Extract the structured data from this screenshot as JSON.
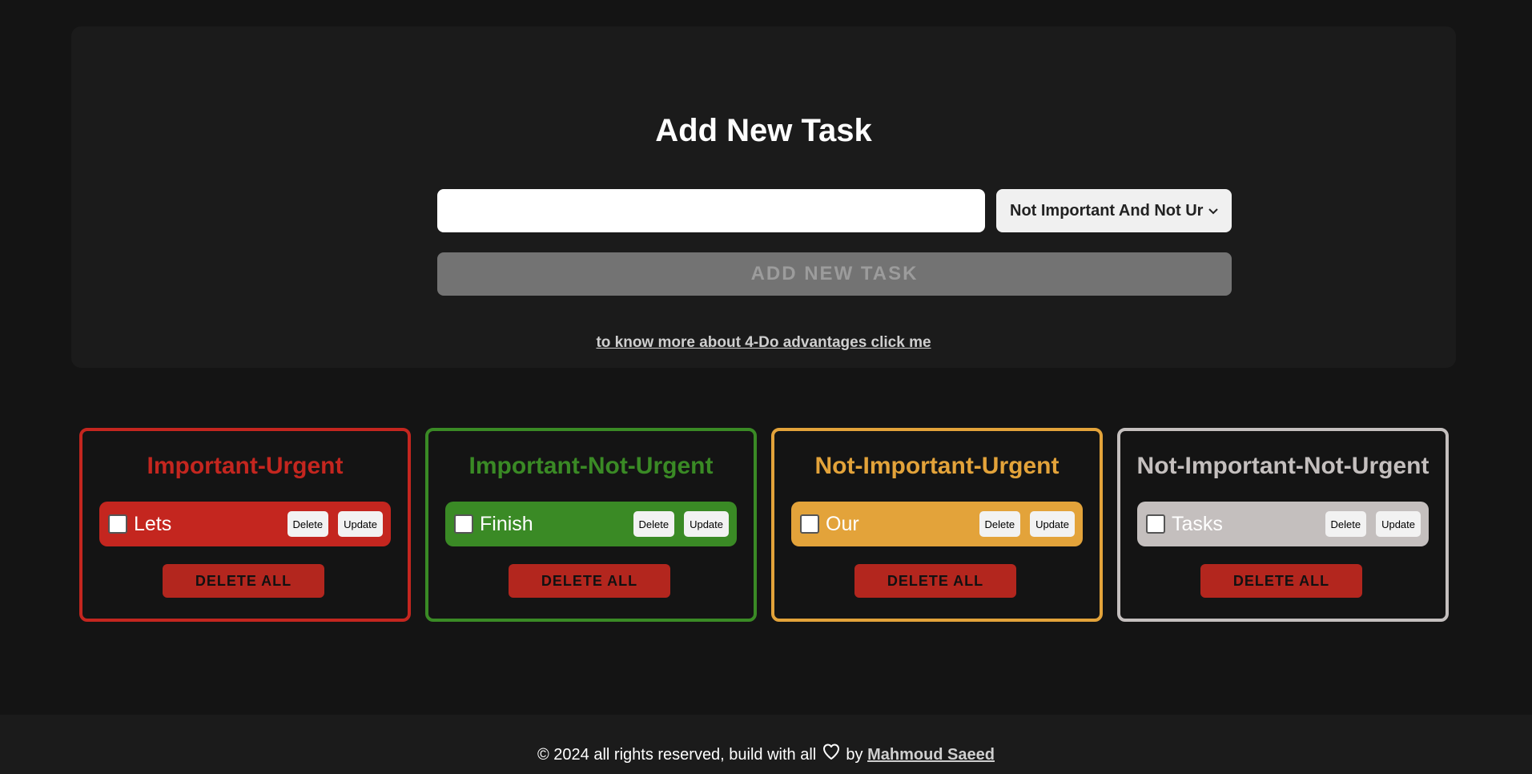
{
  "colors": {
    "page_bg": "#141414",
    "panel_bg": "#1b1b1b",
    "important_urgent": "#c4261f",
    "important_not_urgent": "#3a8a25",
    "not_important_urgent": "#e3a33a",
    "not_important_not_urgent": "#c4bfbe",
    "delete_all_bg": "#b3261e",
    "add_button_bg": "#737373"
  },
  "add_panel": {
    "title": "Add New Task",
    "task_input_value": "",
    "category_selected": "Not Important And Not Urgent",
    "category_visible_text": "Not Important And Not Ur",
    "add_button_label": "ADD NEW TASK",
    "info_link": "to know more about 4-Do advantages click me"
  },
  "boards": [
    {
      "title": "Important-Urgent",
      "tasks": [
        {
          "text": "Lets",
          "delete_label": "Delete",
          "update_label": "Update"
        }
      ],
      "delete_all_label": "DELETE ALL"
    },
    {
      "title": "Important-Not-Urgent",
      "tasks": [
        {
          "text": "Finish",
          "delete_label": "Delete",
          "update_label": "Update"
        }
      ],
      "delete_all_label": "DELETE ALL"
    },
    {
      "title": "Not-Important-Urgent",
      "tasks": [
        {
          "text": "Our",
          "delete_label": "Delete",
          "update_label": "Update"
        }
      ],
      "delete_all_label": "DELETE ALL"
    },
    {
      "title": "Not-Important-Not-Urgent",
      "tasks": [
        {
          "text": "Tasks",
          "delete_label": "Delete",
          "update_label": "Update"
        }
      ],
      "delete_all_label": "DELETE ALL"
    }
  ],
  "footer": {
    "text_before_heart": "© 2024 all rights reserved, build with all",
    "heart_icon": "heart-outline-icon",
    "text_after_heart": "by",
    "author": "Mahmoud Saeed"
  }
}
